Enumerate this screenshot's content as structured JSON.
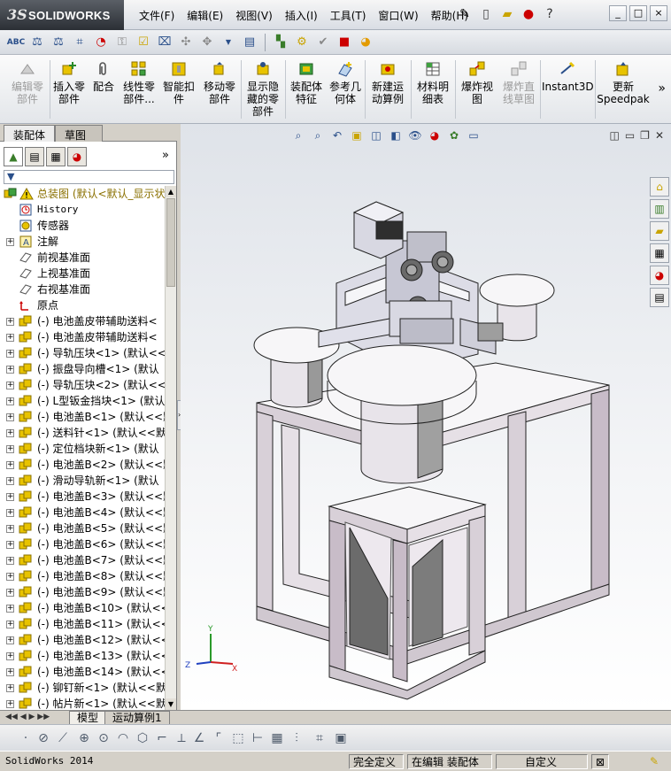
{
  "app": {
    "logo_ds": "3S",
    "logo_name": "SOLIDWORKS"
  },
  "menu": [
    "文件(F)",
    "编辑(E)",
    "视图(V)",
    "插入(I)",
    "工具(T)",
    "窗口(W)",
    "帮助(H)"
  ],
  "window_buttons": [
    "_",
    "□",
    "×"
  ],
  "command_manager": {
    "items": [
      {
        "label": "编辑零\n部件",
        "disabled": true
      },
      {
        "label": "插入零\n部件",
        "disabled": false
      },
      {
        "label": "配合",
        "disabled": false
      },
      {
        "label": "线性零\n部件...",
        "disabled": false
      },
      {
        "label": "智能扣\n件",
        "disabled": false
      },
      {
        "label": "移动零\n部件",
        "disabled": false
      },
      {
        "label": "显示隐\n藏的零\n部件",
        "disabled": false
      },
      {
        "label": "装配体\n特征",
        "disabled": false
      },
      {
        "label": "参考几\n何体",
        "disabled": false
      },
      {
        "label": "新建运\n动算例",
        "disabled": false
      },
      {
        "label": "材料明\n细表",
        "disabled": false
      },
      {
        "label": "爆炸视\n图",
        "disabled": false
      },
      {
        "label": "爆炸直\n线草图",
        "disabled": true
      },
      {
        "label": "Instant3D",
        "disabled": false
      },
      {
        "label": "更新\nSpeedpak",
        "disabled": false
      }
    ],
    "more": "»"
  },
  "left_tabs": [
    "装配体",
    "草图"
  ],
  "panel_more": "»",
  "tree": {
    "root": "总装图  (默认<默认_显示状",
    "items": [
      {
        "text": "History",
        "kind": "history",
        "expand": false
      },
      {
        "text": "传感器",
        "kind": "sensor",
        "expand": false
      },
      {
        "text": "注解",
        "kind": "annotation",
        "expand": true
      },
      {
        "text": "前视基准面",
        "kind": "plane",
        "expand": false
      },
      {
        "text": "上视基准面",
        "kind": "plane",
        "expand": false
      },
      {
        "text": "右视基准面",
        "kind": "plane",
        "expand": false
      },
      {
        "text": "原点",
        "kind": "origin",
        "expand": false
      },
      {
        "text": "(-) 电池盖皮带辅助送料<",
        "kind": "part",
        "expand": true
      },
      {
        "text": "(-) 电池盖皮带辅助送料<",
        "kind": "part",
        "expand": true
      },
      {
        "text": "(-) 导轨压块<1> (默认<<",
        "kind": "part",
        "expand": true
      },
      {
        "text": "(-) 振盘导向槽<1> (默认",
        "kind": "part",
        "expand": true
      },
      {
        "text": "(-) 导轨压块<2> (默认<<",
        "kind": "part",
        "expand": true
      },
      {
        "text": "(-) L型钣金挡块<1> (默认",
        "kind": "part",
        "expand": true
      },
      {
        "text": "(-) 电池盖B<1> (默认<<默",
        "kind": "part",
        "expand": true
      },
      {
        "text": "(-) 送料针<1> (默认<<默",
        "kind": "part",
        "expand": true
      },
      {
        "text": "(-) 定位档块新<1> (默认",
        "kind": "part",
        "expand": true
      },
      {
        "text": "(-) 电池盖B<2> (默认<<默",
        "kind": "part",
        "expand": true
      },
      {
        "text": "(-) 滑动导轨新<1> (默认",
        "kind": "part",
        "expand": true
      },
      {
        "text": "(-) 电池盖B<3> (默认<<默",
        "kind": "part",
        "expand": true
      },
      {
        "text": "(-) 电池盖B<4> (默认<<默",
        "kind": "part",
        "expand": true
      },
      {
        "text": "(-) 电池盖B<5> (默认<<默",
        "kind": "part",
        "expand": true
      },
      {
        "text": "(-) 电池盖B<6> (默认<<默",
        "kind": "part",
        "expand": true
      },
      {
        "text": "(-) 电池盖B<7> (默认<<默",
        "kind": "part",
        "expand": true
      },
      {
        "text": "(-) 电池盖B<8> (默认<<默",
        "kind": "part",
        "expand": true
      },
      {
        "text": "(-) 电池盖B<9> (默认<<默",
        "kind": "part",
        "expand": true
      },
      {
        "text": "(-) 电池盖B<10> (默认<<",
        "kind": "part",
        "expand": true
      },
      {
        "text": "(-) 电池盖B<11> (默认<<",
        "kind": "part",
        "expand": true
      },
      {
        "text": "(-) 电池盖B<12> (默认<<",
        "kind": "part",
        "expand": true
      },
      {
        "text": "(-) 电池盖B<13> (默认<<",
        "kind": "part",
        "expand": true
      },
      {
        "text": "(-) 电池盖B<14> (默认<<",
        "kind": "part",
        "expand": true
      },
      {
        "text": "(-) 铆钉新<1> (默认<<默",
        "kind": "part",
        "expand": true
      },
      {
        "text": "(-) 帖片新<1> (默认<<默",
        "kind": "part",
        "expand": true
      }
    ]
  },
  "model_tabs": [
    "模型",
    "运动算例1"
  ],
  "model_nav": "◀◀ ◀ ▶ ▶▶",
  "status": {
    "app_name": "SolidWorks 2014",
    "defined": "完全定义",
    "editing": "在编辑 装配体",
    "units": "自定义"
  },
  "triad": {
    "y": "Y",
    "z": "Z",
    "x": "X"
  },
  "colors": {
    "frame_fill": "#f0eef2",
    "frame_side": "#c8bcc8",
    "accent": "#2a4f8a"
  }
}
